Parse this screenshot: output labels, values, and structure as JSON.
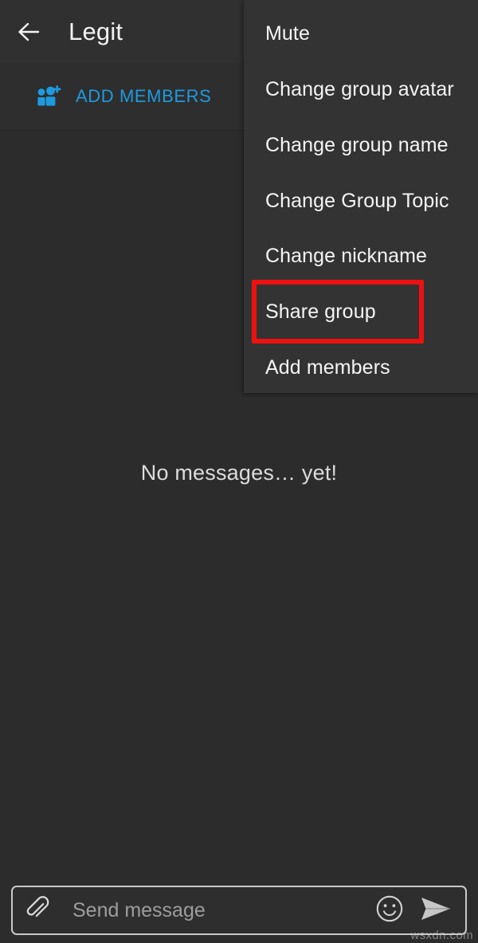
{
  "appbar": {
    "back_icon": "arrow-left-icon",
    "title": "Legit"
  },
  "add_members_bar": {
    "icon": "add-people-icon",
    "label": "ADD MEMBERS",
    "accent_color": "#1e9ae0"
  },
  "conversation": {
    "empty_state": "No messages… yet!"
  },
  "overflow_menu": {
    "items": [
      {
        "label": "Mute"
      },
      {
        "label": "Change group avatar"
      },
      {
        "label": "Change group name"
      },
      {
        "label": "Change Group Topic"
      },
      {
        "label": "Change nickname"
      },
      {
        "label": "Share group"
      },
      {
        "label": "Add members"
      }
    ],
    "highlighted_item": "Share group",
    "highlight_color": "#ee1111"
  },
  "composer": {
    "attach_icon": "paperclip-icon",
    "input_value": "",
    "input_placeholder": "Send message",
    "emoji_icon": "smiley-icon",
    "send_icon": "send-icon"
  },
  "watermark": {
    "text": "wsxdn.com"
  },
  "theme": {
    "background": "#2c2c2c",
    "appbar_background": "#303030",
    "menu_background": "#333333",
    "text_primary": "#f5f5f5"
  }
}
